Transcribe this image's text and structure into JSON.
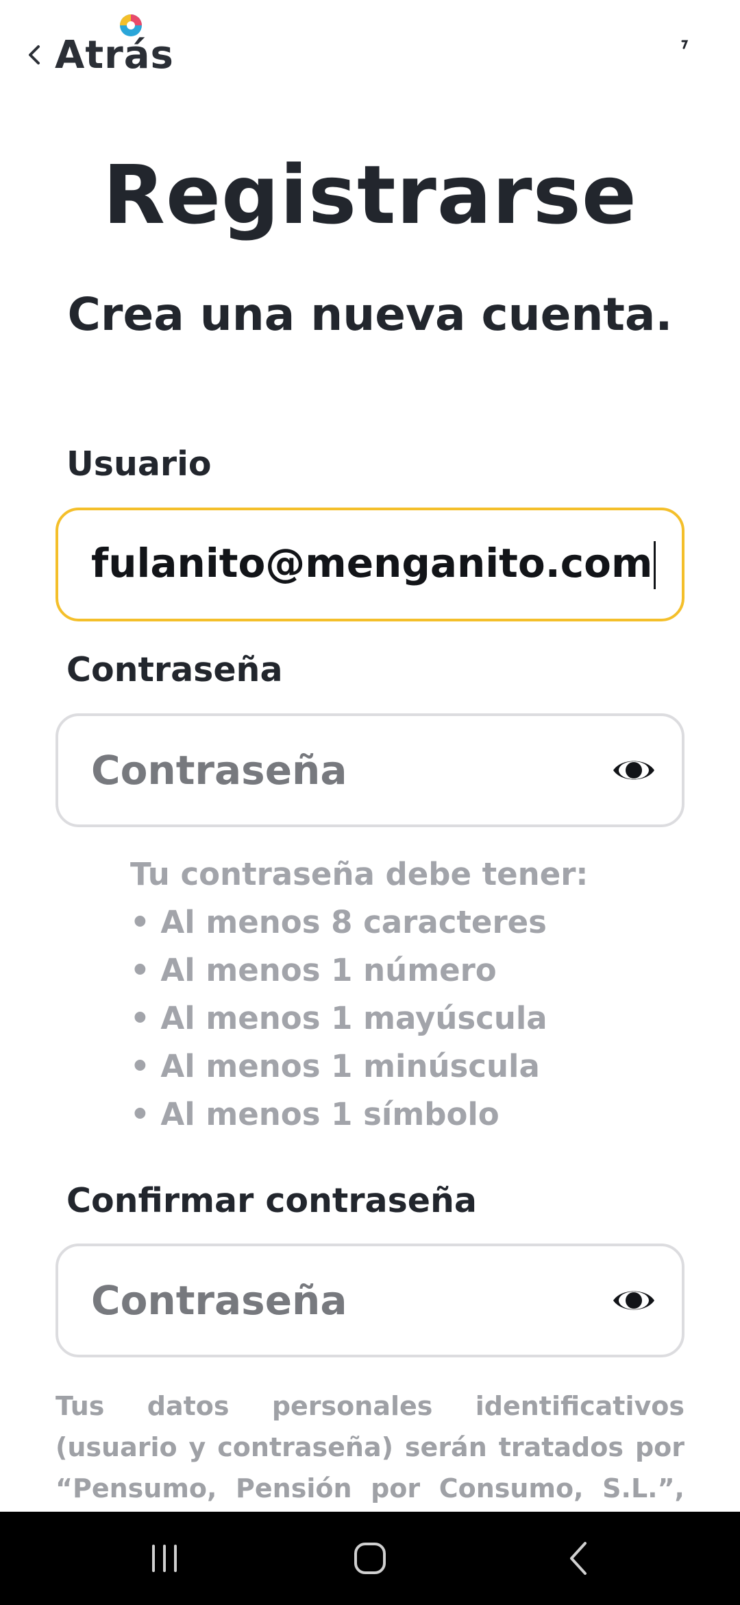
{
  "header": {
    "back_label": "Atrás",
    "brand_colors": [
      "#f4bf2a",
      "#e84a6a",
      "#2aa6d9"
    ]
  },
  "title": "Registrarse",
  "subtitle": "Crea una nueva cuenta.",
  "username": {
    "label": "Usuario",
    "value": "fulanito@menganito.com"
  },
  "password": {
    "label": "Contraseña",
    "placeholder": "Contraseña",
    "icon": "eye-icon"
  },
  "requirements": {
    "heading": "Tu contraseña debe tener:",
    "items": [
      "• Al menos 8 caracteres",
      "• Al menos 1 número",
      "• Al menos 1 mayúscula",
      "• Al menos 1 minúscula",
      "• Al menos 1 símbolo"
    ]
  },
  "confirm_password": {
    "label": "Confirmar contraseña",
    "placeholder": "Contraseña",
    "icon": "eye-icon"
  },
  "disclaimer": "Tus datos personales identificativos (usuario y contraseña) serán tratados por “Pensumo, Pensión por Consumo, S.L.”, con",
  "colors": {
    "focus_border": "#f4bf2a",
    "input_border": "#dcdcdf",
    "hint_text": "#a2a4aa",
    "navbar": "#000000"
  },
  "navbar": {
    "recents_icon": "recents-icon",
    "home_icon": "home-icon",
    "back_icon": "back-icon"
  }
}
